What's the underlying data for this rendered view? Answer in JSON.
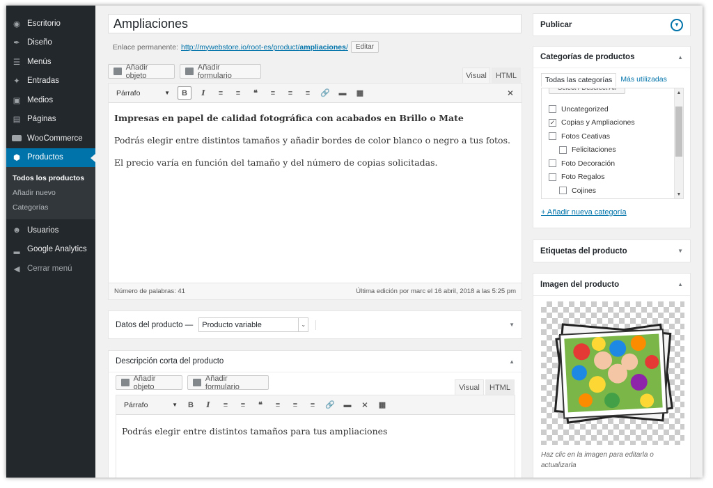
{
  "sidebar": {
    "items": [
      {
        "label": "Escritorio",
        "icon": "dashboard-icon"
      },
      {
        "label": "Diseño",
        "icon": "brush-icon"
      },
      {
        "label": "Menús",
        "icon": "menu-icon"
      },
      {
        "label": "Entradas",
        "icon": "pin-icon"
      },
      {
        "label": "Medios",
        "icon": "media-icon"
      },
      {
        "label": "Páginas",
        "icon": "page-icon"
      },
      {
        "label": "WooCommerce",
        "icon": "woo-icon"
      },
      {
        "label": "Productos",
        "icon": "product-icon"
      }
    ],
    "submenu": [
      "Todos los productos",
      "Añadir nuevo",
      "Categorías"
    ],
    "items_after": [
      {
        "label": "Usuarios",
        "icon": "users-icon"
      },
      {
        "label": "Google Analytics",
        "icon": "analytics-icon"
      },
      {
        "label": "Cerrar menú",
        "icon": "collapse-icon"
      }
    ]
  },
  "post": {
    "title": "Ampliaciones",
    "permalink_label": "Enlace permanente:",
    "permalink_prefix": "http://mywebstore.io/root-es/product/",
    "permalink_slug": "ampliaciones",
    "permalink_suffix": "/",
    "edit_label": "Editar"
  },
  "editor": {
    "add_media": "Añadir objeto",
    "add_form": "Añadir formulario",
    "tab_visual": "Visual",
    "tab_html": "HTML",
    "format": "Párrafo",
    "heading": "Impresas en papel de calidad fotográfica con acabados en Brillo o Mate",
    "para1": "Podrás elegir entre distintos tamaños y añadir bordes de color blanco o negro a tus fotos.",
    "para2": "El precio varía en función del tamaño y del número de copias solicitadas.",
    "word_count": "Número de palabras: 41",
    "last_edit": "Última edición por marc el 16 abril, 2018 a las 5:25 pm"
  },
  "product_data": {
    "label": "Datos del producto —",
    "type": "Producto variable"
  },
  "short_desc": {
    "title": "Descripción corta del producto",
    "add_media": "Añadir objeto",
    "add_form": "Añadir formulario",
    "tab_visual": "Visual",
    "tab_html": "HTML",
    "format": "Párrafo",
    "text": "Podrás elegir entre distintos tamaños para tus ampliaciones"
  },
  "publish": {
    "title": "Publicar"
  },
  "categories": {
    "title": "Categorías de productos",
    "tab_all": "Todas las categorías",
    "tab_popular": "Más utilizadas",
    "select_btn": "Select / Deselect All",
    "items": [
      {
        "label": "Uncategorized",
        "checked": false,
        "child": false
      },
      {
        "label": "Copias y Ampliaciones",
        "checked": true,
        "child": false
      },
      {
        "label": "Fotos Ceativas",
        "checked": false,
        "child": false
      },
      {
        "label": "Felicitaciones",
        "checked": false,
        "child": true
      },
      {
        "label": "Foto Decoración",
        "checked": false,
        "child": false
      },
      {
        "label": "Foto Regalos",
        "checked": false,
        "child": false
      },
      {
        "label": "Cojines",
        "checked": false,
        "child": true
      }
    ],
    "add_new": "+ Añadir nueva categoría"
  },
  "tags": {
    "title": "Etiquetas del producto"
  },
  "image": {
    "title": "Imagen del producto",
    "hint": "Haz clic en la imagen para editarla o actualizarla"
  },
  "colors": {
    "sidebar": "#23282d",
    "accent": "#0073aa",
    "background": "#f1f1f1"
  }
}
